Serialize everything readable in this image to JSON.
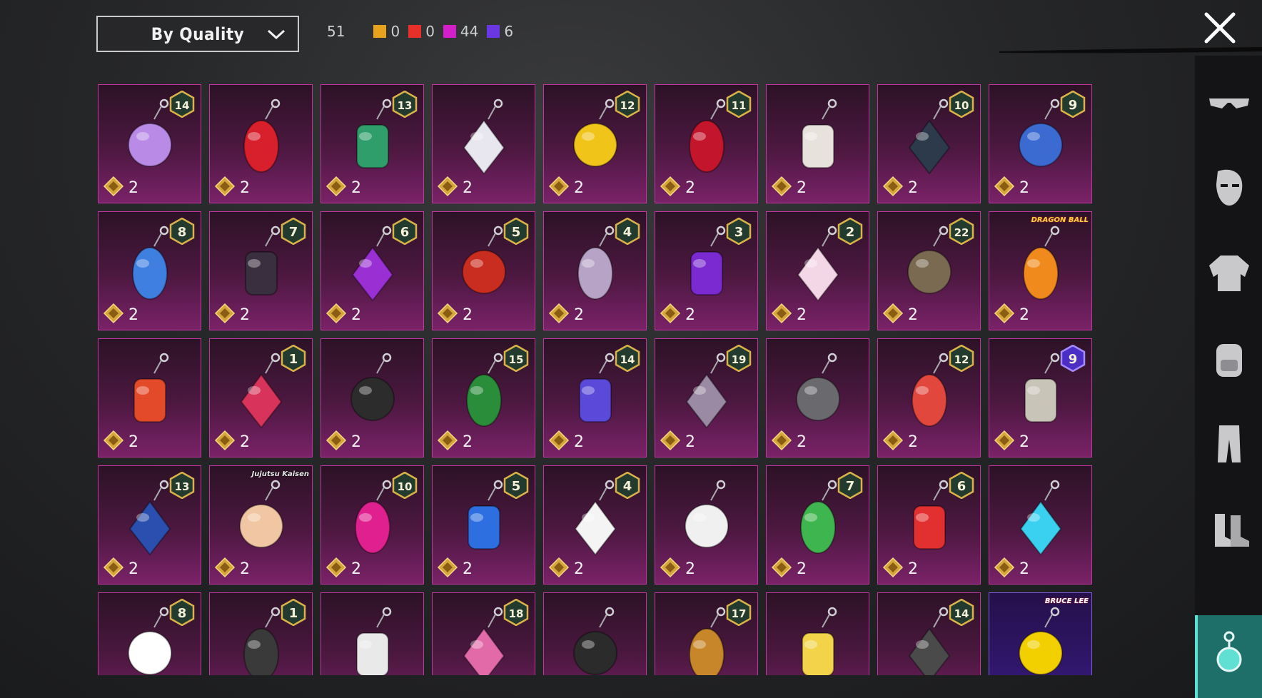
{
  "sort": {
    "label": "By Quality"
  },
  "counts": {
    "total": "51",
    "by_quality": [
      {
        "color": "#e9a21b",
        "value": "0"
      },
      {
        "color": "#e8302a",
        "value": "0"
      },
      {
        "color": "#d21fc9",
        "value": "44"
      },
      {
        "color": "#6a37e3",
        "value": "6"
      }
    ]
  },
  "items": [
    {
      "icon": "purple-cat-charm-icon",
      "badge": "14",
      "level": "2"
    },
    {
      "icon": "red-gem-charm-icon",
      "badge": "",
      "level": "2"
    },
    {
      "icon": "bunny-mirror-charm-icon",
      "badge": "13",
      "level": "2"
    },
    {
      "icon": "spaceship-charm-icon",
      "badge": "",
      "level": "2"
    },
    {
      "icon": "sunflower-charm-icon",
      "badge": "12",
      "level": "2"
    },
    {
      "icon": "red-crystal-charm-icon",
      "badge": "11",
      "level": "2"
    },
    {
      "icon": "koi-fish-charm-icon",
      "badge": "",
      "level": "2"
    },
    {
      "icon": "dark-glove-charm-icon",
      "badge": "10",
      "level": "2"
    },
    {
      "icon": "blue-snowman-charm-icon",
      "badge": "9",
      "level": "2"
    },
    {
      "icon": "seahorse-charm-icon",
      "badge": "8",
      "level": "2"
    },
    {
      "icon": "phone-charm-icon",
      "badge": "7",
      "level": "2"
    },
    {
      "icon": "purple-dagger-charm-icon",
      "badge": "6",
      "level": "2"
    },
    {
      "icon": "firecracker-charm-icon",
      "badge": "5",
      "level": "2"
    },
    {
      "icon": "astronaut-helmet-charm-icon",
      "badge": "4",
      "level": "2"
    },
    {
      "icon": "disco-ball-charm-icon",
      "badge": "3",
      "level": "2"
    },
    {
      "icon": "unicorn-charm-icon",
      "badge": "2",
      "level": "2"
    },
    {
      "icon": "compass-charm-icon",
      "badge": "22",
      "level": "2"
    },
    {
      "icon": "dragon-ball-charm-icon",
      "badge": "",
      "level": "2",
      "logo": "DRAGON BALL"
    },
    {
      "icon": "lucky-cat-charm-icon",
      "badge": "",
      "level": "2"
    },
    {
      "icon": "robot-tank-charm-icon",
      "badge": "1",
      "level": "2"
    },
    {
      "icon": "boxing-glove-charm-icon",
      "badge": "",
      "level": "2"
    },
    {
      "icon": "jack-in-box-charm-icon",
      "badge": "15",
      "level": "2"
    },
    {
      "icon": "purple-bracelet-charm-icon",
      "badge": "14",
      "level": "2"
    },
    {
      "icon": "octopus-eye-charm-icon",
      "badge": "19",
      "level": "2"
    },
    {
      "icon": "metal-apple-charm-icon",
      "badge": "",
      "level": "2"
    },
    {
      "icon": "ufo-charm-icon",
      "badge": "12",
      "level": "2"
    },
    {
      "icon": "nautilus-charm-icon",
      "badge": "9",
      "level": "2",
      "badge_tier": "purple"
    },
    {
      "icon": "blue-banner-charm-icon",
      "badge": "13",
      "level": "2"
    },
    {
      "icon": "anime-boy-charm-icon",
      "badge": "",
      "level": "2",
      "logo": "Jujutsu Kaisen"
    },
    {
      "icon": "pink-monster-ball-charm-icon",
      "badge": "10",
      "level": "2"
    },
    {
      "icon": "blue-crystal-charm-icon",
      "badge": "5",
      "level": "2"
    },
    {
      "icon": "chess-knight-charm-icon",
      "badge": "4",
      "level": "2"
    },
    {
      "icon": "drum-charm-icon",
      "badge": "",
      "level": "2"
    },
    {
      "icon": "winged-egg-charm-icon",
      "badge": "7",
      "level": "2"
    },
    {
      "icon": "gnome-charm-icon",
      "badge": "6",
      "level": "2"
    },
    {
      "icon": "blue-stag-charm-icon",
      "badge": "",
      "level": "2"
    },
    {
      "icon": "cow-charm-icon",
      "badge": "8",
      "level": ""
    },
    {
      "icon": "small-ring-charm-icon",
      "badge": "1",
      "level": ""
    },
    {
      "icon": "tiny-figure-charm-icon",
      "badge": "",
      "level": ""
    },
    {
      "icon": "pink-guitar-charm-icon",
      "badge": "18",
      "level": ""
    },
    {
      "icon": "top-hat-charm-icon",
      "badge": "",
      "level": ""
    },
    {
      "icon": "lantern-charm-icon",
      "badge": "17",
      "level": ""
    },
    {
      "icon": "duck-witch-charm-icon",
      "badge": "",
      "level": ""
    },
    {
      "icon": "spiked-helmet-charm-icon",
      "badge": "14",
      "level": ""
    },
    {
      "icon": "bruce-lee-charm-icon",
      "badge": "",
      "level": "",
      "logo": "BRUCE LEE",
      "tier": "special"
    }
  ],
  "sidebar": [
    {
      "icon": "glasses-icon"
    },
    {
      "icon": "mask-icon"
    },
    {
      "icon": "jacket-icon"
    },
    {
      "icon": "backpack-icon"
    },
    {
      "icon": "pants-icon"
    },
    {
      "icon": "boots-icon"
    },
    {
      "icon": "charm-icon",
      "active": true
    }
  ]
}
